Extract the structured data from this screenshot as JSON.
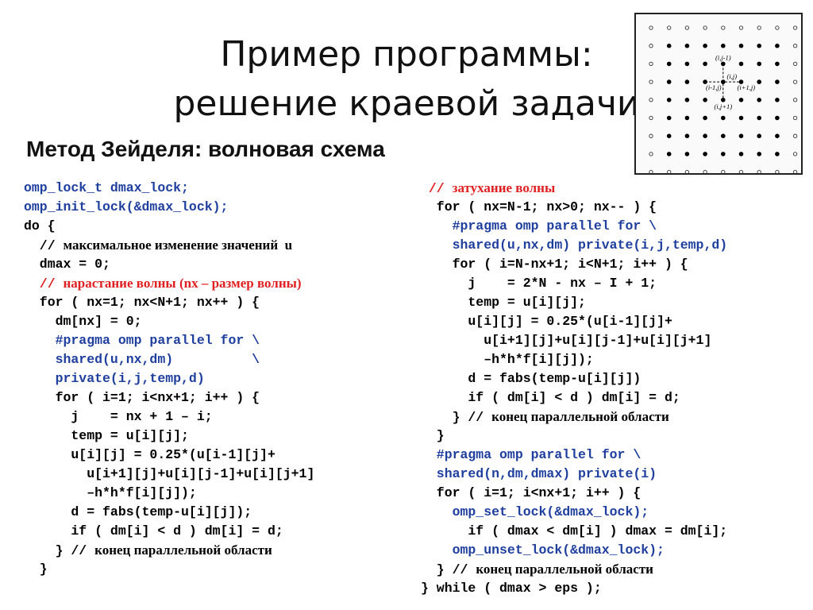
{
  "slide": {
    "title_line1": "Пример программы:",
    "title_line2": "решение краевой задачи",
    "subtitle": "Метод Зейделя: волновая схема"
  },
  "diagram": {
    "labels": {
      "top": "(i,j-1)",
      "center": "(i,j)",
      "left": "(i-1,j)",
      "right": "(i+1,j)",
      "bottom": "(i,j+1)"
    },
    "grid_size": 9
  },
  "colors": {
    "code_blue": "#1f3f9f",
    "comment_red": "#e02020",
    "text": "#000000"
  },
  "left_code": [
    {
      "indent": 0,
      "style": "blue",
      "text": "omp_lock_t dmax_lock;"
    },
    {
      "indent": 0,
      "style": "blue",
      "text": "omp_init_lock(&dmax_lock);"
    },
    {
      "indent": 0,
      "style": "plain",
      "text": "do {"
    },
    {
      "indent": 1,
      "style": "comment",
      "code": "// ",
      "text": "максимальное изменение значений  u"
    },
    {
      "indent": 1,
      "style": "plain",
      "text": "dmax = 0;"
    },
    {
      "indent": 1,
      "style": "redcomment",
      "code": "// ",
      "text": "нарастание волны (nx – размер волны)"
    },
    {
      "indent": 1,
      "style": "plain",
      "text": "for ( nx=1; nx<N+1; nx++ ) {"
    },
    {
      "indent": 2,
      "style": "plain",
      "text": "dm[nx] = 0;"
    },
    {
      "indent": 2,
      "style": "blue",
      "text": "#pragma omp parallel for \\"
    },
    {
      "indent": 2,
      "style": "blue",
      "text": "shared(u,nx,dm)          \\"
    },
    {
      "indent": 2,
      "style": "blue",
      "text": "private(i,j,temp,d)"
    },
    {
      "indent": 2,
      "style": "plain",
      "text": "for ( i=1; i<nx+1; i++ ) {"
    },
    {
      "indent": 3,
      "style": "plain",
      "text": "j    = nx + 1 – i;"
    },
    {
      "indent": 3,
      "style": "plain",
      "text": "temp = u[i][j];"
    },
    {
      "indent": 3,
      "style": "plain",
      "text": "u[i][j] = 0.25*(u[i-1][j]+"
    },
    {
      "indent": 4,
      "style": "plain",
      "text": "u[i+1][j]+u[i][j-1]+u[i][j+1]"
    },
    {
      "indent": 4,
      "style": "plain",
      "text": "–h*h*f[i][j]);"
    },
    {
      "indent": 3,
      "style": "plain",
      "text": "d = fabs(temp-u[i][j]);"
    },
    {
      "indent": 3,
      "style": "plain",
      "text": "if ( dm[i] < d ) dm[i] = d;"
    },
    {
      "indent": 2,
      "style": "comment",
      "code": "} // ",
      "text": "конец параллельной области"
    },
    {
      "indent": 1,
      "style": "plain",
      "text": "}"
    }
  ],
  "right_code": [
    {
      "indent": 0,
      "style": "redcomment",
      "code": " // ",
      "text": "затухание волны"
    },
    {
      "indent": 1,
      "style": "plain",
      "text": "for ( nx=N-1; nx>0; nx-- ) {"
    },
    {
      "indent": 2,
      "style": "blue",
      "text": "#pragma omp parallel for \\"
    },
    {
      "indent": 2,
      "style": "blue",
      "text": "shared(u,nx,dm) private(i,j,temp,d)"
    },
    {
      "indent": 2,
      "style": "plain",
      "text": "for ( i=N-nx+1; i<N+1; i++ ) {"
    },
    {
      "indent": 3,
      "style": "plain",
      "text": "j    = 2*N - nx – I + 1;"
    },
    {
      "indent": 3,
      "style": "plain",
      "text": "temp = u[i][j];"
    },
    {
      "indent": 3,
      "style": "plain",
      "text": "u[i][j] = 0.25*(u[i-1][j]+"
    },
    {
      "indent": 4,
      "style": "plain",
      "text": "u[i+1][j]+u[i][j-1]+u[i][j+1]"
    },
    {
      "indent": 4,
      "style": "plain",
      "text": "–h*h*f[i][j]);"
    },
    {
      "indent": 3,
      "style": "plain",
      "text": "d = fabs(temp-u[i][j])"
    },
    {
      "indent": 3,
      "style": "plain",
      "text": "if ( dm[i] < d ) dm[i] = d;"
    },
    {
      "indent": 2,
      "style": "comment",
      "code": "} // ",
      "text": "конец параллельной области"
    },
    {
      "indent": 1,
      "style": "plain",
      "text": "}"
    },
    {
      "indent": 1,
      "style": "blue",
      "text": "#pragma omp parallel for \\"
    },
    {
      "indent": 1,
      "style": "blue",
      "text": "shared(n,dm,dmax) private(i)"
    },
    {
      "indent": 1,
      "style": "plain",
      "text": "for ( i=1; i<nx+1; i++ ) {"
    },
    {
      "indent": 2,
      "style": "blue",
      "text": "omp_set_lock(&dmax_lock);"
    },
    {
      "indent": 3,
      "style": "plain",
      "text": "if ( dmax < dm[i] ) dmax = dm[i];"
    },
    {
      "indent": 2,
      "style": "blue",
      "text": "omp_unset_lock(&dmax_lock);"
    },
    {
      "indent": 1,
      "style": "comment",
      "code": "} // ",
      "text": "конец параллельной области"
    },
    {
      "indent": 0,
      "style": "plain",
      "text": "} while ( dmax > eps );"
    }
  ]
}
